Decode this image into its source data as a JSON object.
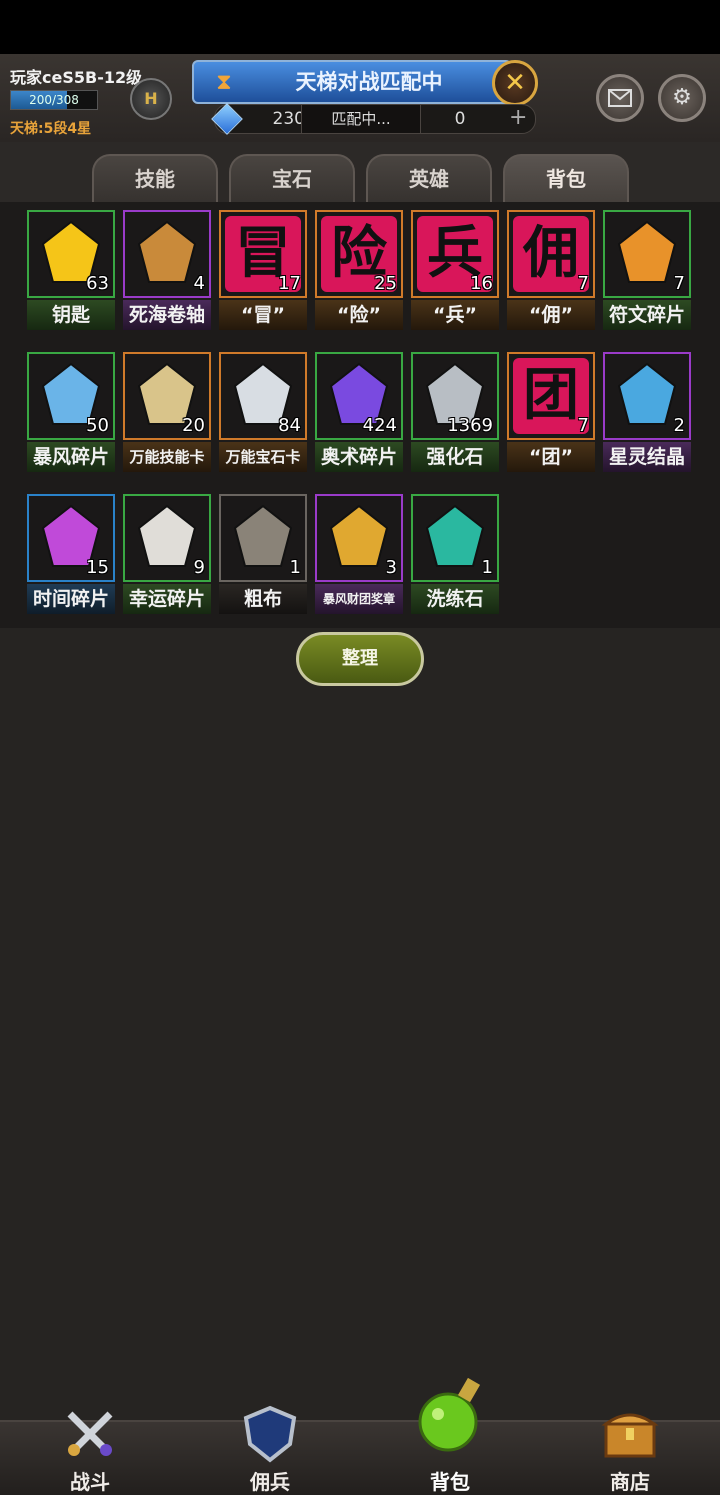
{
  "header": {
    "player_name": "玩家ceS5B-12级",
    "xp_text": "200/308",
    "xp_fraction": 0.649,
    "ladder_text": "天梯:5段4星",
    "rank_letter": "H",
    "match_title": "天梯对战匹配中",
    "close_label": "✕",
    "gem_count": "230",
    "match_status": "匹配中...",
    "second_count": "0",
    "plus_label": "+"
  },
  "tabs": [
    {
      "label": "技能"
    },
    {
      "label": "宝石"
    },
    {
      "label": "英雄"
    },
    {
      "label": "背包"
    }
  ],
  "active_tab": "背包",
  "items": [
    {
      "name": "钥匙",
      "count": "63",
      "rarity": "green",
      "icon": "lightning-key-icon",
      "color": "#f5c518"
    },
    {
      "name": "死海卷轴",
      "count": "4",
      "rarity": "purple",
      "icon": "scroll-icon",
      "color": "#c98a3a"
    },
    {
      "name": "“冒”",
      "count": "17",
      "rarity": "orange",
      "icon": "char-mao-icon",
      "char": "冒"
    },
    {
      "name": "“险”",
      "count": "25",
      "rarity": "orange",
      "icon": "char-xian-icon",
      "char": "险"
    },
    {
      "name": "“兵”",
      "count": "16",
      "rarity": "orange",
      "icon": "char-bing-icon",
      "char": "兵"
    },
    {
      "name": "“佣”",
      "count": "7",
      "rarity": "orange",
      "icon": "char-yong-icon",
      "char": "佣"
    },
    {
      "name": "符文碎片",
      "count": "7",
      "rarity": "green",
      "icon": "rune-shard-icon",
      "color": "#e8922a"
    },
    {
      "name": "暴风碎片",
      "count": "50",
      "rarity": "green",
      "icon": "storm-shard-icon",
      "color": "#6ab4e8"
    },
    {
      "name": "万能技能卡",
      "count": "20",
      "rarity": "orange",
      "icon": "skill-book-icon",
      "color": "#d9c48a"
    },
    {
      "name": "万能宝石卡",
      "count": "84",
      "rarity": "orange",
      "icon": "diamond-icon",
      "color": "#d8dde3"
    },
    {
      "name": "奥术碎片",
      "count": "424",
      "rarity": "green",
      "icon": "arcane-crystal-icon",
      "color": "#7a4ae0"
    },
    {
      "name": "强化石",
      "count": "1369",
      "rarity": "green",
      "icon": "enhance-stone-icon",
      "color": "#b8bec4"
    },
    {
      "name": "“团”",
      "count": "7",
      "rarity": "orange",
      "icon": "char-tuan-icon",
      "char": "团"
    },
    {
      "name": "星灵结晶",
      "count": "2",
      "rarity": "purple",
      "icon": "star-crystal-icon",
      "color": "#4aa8e0"
    },
    {
      "name": "时间碎片",
      "count": "15",
      "rarity": "blue",
      "icon": "time-gem-icon",
      "color": "#c04ad9"
    },
    {
      "name": "幸运碎片",
      "count": "9",
      "rarity": "green",
      "icon": "lucky-feather-icon",
      "color": "#e0ddd8"
    },
    {
      "name": "粗布",
      "count": "1",
      "rarity": "gray",
      "icon": "cloth-icon",
      "color": "#8a8378"
    },
    {
      "name": "暴风财团奖章",
      "count": "3",
      "rarity": "purple",
      "icon": "guild-medal-icon",
      "color": "#e0a830"
    },
    {
      "name": "洗练石",
      "count": "1",
      "rarity": "green",
      "icon": "refine-stone-icon",
      "color": "#2ab8a0"
    }
  ],
  "sort_button": "整理",
  "nav": [
    {
      "label": "战斗",
      "icon": "crossed-swords-icon"
    },
    {
      "label": "佣兵",
      "icon": "shield-icon"
    },
    {
      "label": "背包",
      "icon": "potion-icon"
    },
    {
      "label": "商店",
      "icon": "treasure-chest-icon"
    }
  ],
  "active_nav": "背包"
}
